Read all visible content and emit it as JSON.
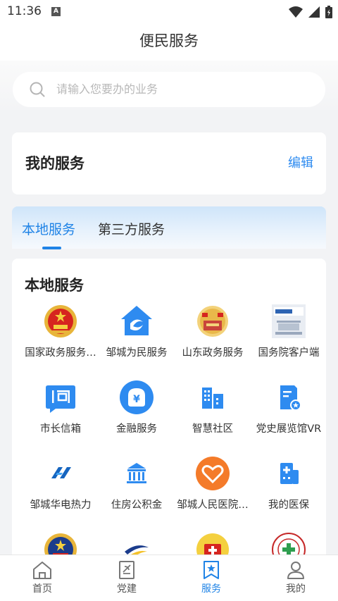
{
  "status_bar": {
    "time": "11:36",
    "notification_letter": "A"
  },
  "title": "便民服务",
  "search": {
    "placeholder": "请输入您要办的业务"
  },
  "my_services": {
    "title": "我的服务",
    "edit_label": "编辑"
  },
  "tabs": [
    {
      "label": "本地服务",
      "active": true
    },
    {
      "label": "第三方服务",
      "active": false
    }
  ],
  "local_services": {
    "title": "本地服务",
    "items": [
      {
        "label": "国家政务服务…",
        "icon": "national-emblem-icon"
      },
      {
        "label": "邹城为民服务",
        "icon": "house-icon"
      },
      {
        "label": "山东政务服务",
        "icon": "shandong-gov-icon"
      },
      {
        "label": "国务院客户端",
        "icon": "state-council-icon"
      },
      {
        "label": "市长信箱",
        "icon": "mailbox-icon"
      },
      {
        "label": "金融服务",
        "icon": "finance-icon"
      },
      {
        "label": "智慧社区",
        "icon": "community-icon"
      },
      {
        "label": "党史展览馆VR",
        "icon": "exhibition-icon"
      },
      {
        "label": "邹城华电热力",
        "icon": "huadian-icon"
      },
      {
        "label": "住房公积金",
        "icon": "housing-fund-icon"
      },
      {
        "label": "邹城人民医院…",
        "icon": "hospital-heart-icon"
      },
      {
        "label": "我的医保",
        "icon": "medical-insurance-icon"
      },
      {
        "label": "",
        "icon": "police-emblem-icon"
      },
      {
        "label": "",
        "icon": "swirl-logo-icon"
      },
      {
        "label": "",
        "icon": "first-aid-icon"
      },
      {
        "label": "",
        "icon": "red-cross-seal-icon"
      }
    ]
  },
  "bottom_nav": [
    {
      "label": "首页",
      "icon": "home-icon"
    },
    {
      "label": "党建",
      "icon": "party-book-icon"
    },
    {
      "label": "服务",
      "icon": "service-star-icon",
      "active": true
    },
    {
      "label": "我的",
      "icon": "profile-icon"
    }
  ],
  "colors": {
    "accent": "#1f83e6",
    "icon_blue": "#2e8bf0",
    "orange": "#f47b2a"
  }
}
